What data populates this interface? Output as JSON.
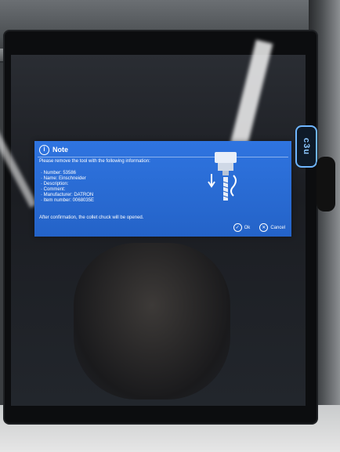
{
  "dialog": {
    "title": "Note",
    "message": "Please remove the tool with the following information:",
    "details": [
      "· Number: 53586",
      "· Name: Einschneider",
      "· Description:",
      "· Comment:",
      "· Manufacturer: DATRON",
      "· Item number: 0068035E"
    ],
    "confirmation": "After confirmation, the collet chuck will be opened.",
    "ok_label": "Ok",
    "cancel_label": "Cancel"
  },
  "monitor": {
    "logo": "c3u"
  },
  "icons": {
    "info": "info-icon",
    "ok": "check-circle-icon",
    "cancel": "close-circle-icon",
    "tool": "tool-removal-illustration"
  },
  "colors": {
    "dialog_bg": "#2f74e0",
    "dialog_text": "#ffffff",
    "badge_border": "#6fb6ff"
  }
}
